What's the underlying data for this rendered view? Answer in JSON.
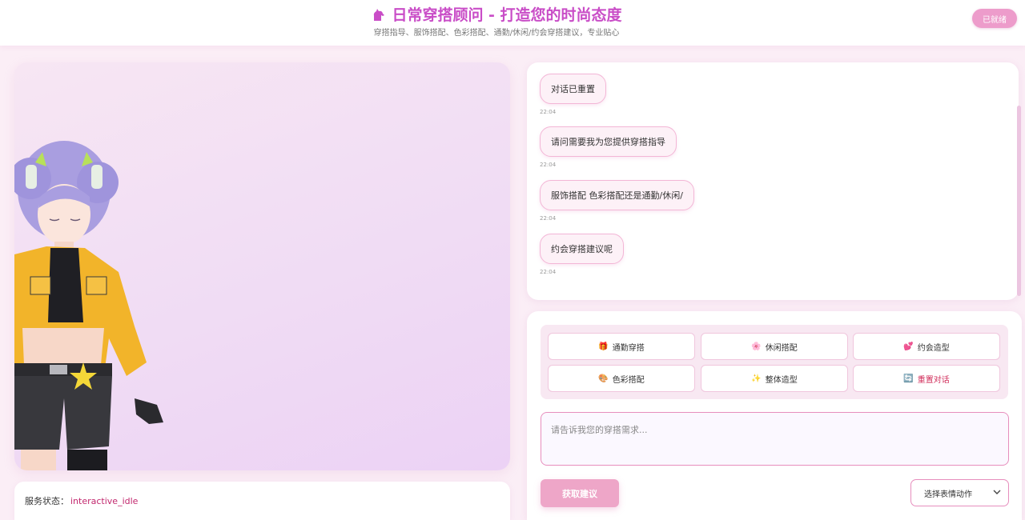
{
  "header": {
    "title": "日常穿搭顾问 - 打造您的时尚态度",
    "subtitle": "穿搭指导、服饰搭配、色彩搭配、通勤/休闲/约会穿搭建议，专业贴心",
    "status": "已就绪"
  },
  "service": {
    "label": "服务状态：",
    "value": "interactive_idle"
  },
  "chat": {
    "messages": [
      {
        "text": "对话已重置",
        "time": "22:04"
      },
      {
        "text": "请问需要我为您提供穿搭指导",
        "time": "22:04"
      },
      {
        "text": "服饰搭配 色彩搭配还是通勤/休闲/",
        "time": "22:04"
      },
      {
        "text": "约会穿搭建议呢",
        "time": "22:04"
      }
    ]
  },
  "quick_actions": [
    {
      "label": "通勤穿搭",
      "icon": "gift-icon",
      "glyph": "🎁"
    },
    {
      "label": "休闲搭配",
      "icon": "flower-icon",
      "glyph": "🌸"
    },
    {
      "label": "约会造型",
      "icon": "heart-icon",
      "glyph": "💕"
    },
    {
      "label": "色彩搭配",
      "icon": "palette-icon",
      "glyph": "🎨"
    },
    {
      "label": "整体造型",
      "icon": "sparkles-icon",
      "glyph": "✨"
    },
    {
      "label": "重置对话",
      "icon": "refresh-icon",
      "glyph": "🔄"
    }
  ],
  "input": {
    "placeholder": "请告诉我您的穿搭需求..."
  },
  "submit_label": "获取建议",
  "emotion_select": {
    "selected": "选择表情动作"
  },
  "colors": {
    "accent": "#c94dc7",
    "pill": "#ed9ccb",
    "status_value": "#c2286e",
    "reset": "#d02c5a"
  }
}
